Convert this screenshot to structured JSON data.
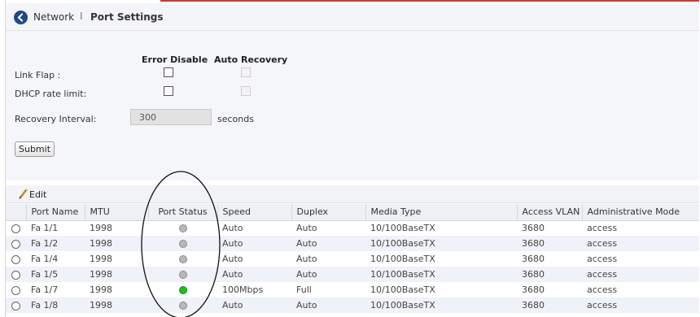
{
  "breadcrumb": {
    "parent": "Network",
    "separator": "I",
    "current": "Port Settings"
  },
  "settings": {
    "col_error_disable": "Error Disable",
    "col_auto_recovery": "Auto Recovery",
    "link_flap_label": "Link Flap :",
    "dhcp_label": "DHCP rate limit:",
    "recovery_interval_label": "Recovery Interval:",
    "recovery_interval_value": "300",
    "seconds_label": "seconds",
    "submit_label": "Submit"
  },
  "toolbar": {
    "edit_label": "Edit",
    "edit_icon": "pencil-icon"
  },
  "table": {
    "columns": [
      "Port Name",
      "MTU",
      "Port Status",
      "Speed",
      "Duplex",
      "Media Type",
      "Access VLAN",
      "Administrative Mode"
    ],
    "rows": [
      {
        "port": "Fa 1/1",
        "mtu": "1998",
        "status": "down",
        "speed": "Auto",
        "duplex": "Auto",
        "media": "10/100BaseTX",
        "vlan": "3680",
        "mode": "access"
      },
      {
        "port": "Fa 1/2",
        "mtu": "1998",
        "status": "down",
        "speed": "Auto",
        "duplex": "Auto",
        "media": "10/100BaseTX",
        "vlan": "3680",
        "mode": "access"
      },
      {
        "port": "Fa 1/4",
        "mtu": "1998",
        "status": "down",
        "speed": "Auto",
        "duplex": "Auto",
        "media": "10/100BaseTX",
        "vlan": "3680",
        "mode": "access"
      },
      {
        "port": "Fa 1/5",
        "mtu": "1998",
        "status": "down",
        "speed": "Auto",
        "duplex": "Auto",
        "media": "10/100BaseTX",
        "vlan": "3680",
        "mode": "access"
      },
      {
        "port": "Fa 1/7",
        "mtu": "1998",
        "status": "up",
        "speed": "100Mbps",
        "duplex": "Full",
        "media": "10/100BaseTX",
        "vlan": "3680",
        "mode": "access"
      },
      {
        "port": "Fa 1/8",
        "mtu": "1998",
        "status": "down",
        "speed": "Auto",
        "duplex": "Auto",
        "media": "10/100BaseTX",
        "vlan": "3680",
        "mode": "access"
      }
    ]
  },
  "colors": {
    "status_up": "#22bb22",
    "status_down": "#b8b8b8",
    "accent": "#1d4a86",
    "top_border": "#b8413a"
  }
}
